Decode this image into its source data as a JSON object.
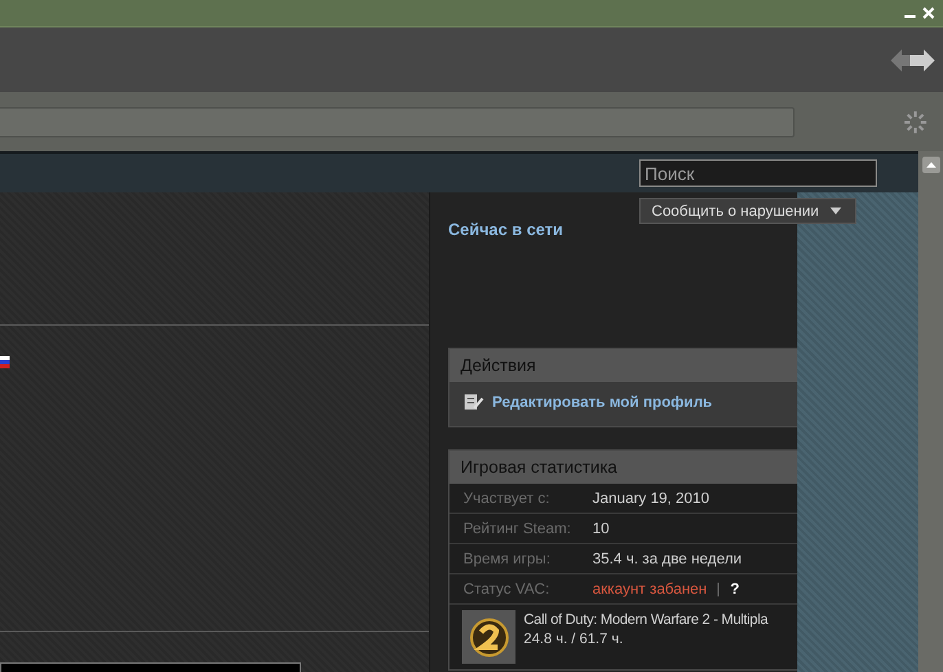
{
  "header": {
    "search": {
      "placeholder": "Поиск"
    }
  },
  "report_button": {
    "label": "Сообщить о нарушении"
  },
  "online_status": "Сейчас в сети",
  "actions": {
    "title": "Действия",
    "items": [
      {
        "label": "Редактировать мой профиль"
      }
    ]
  },
  "stats": {
    "title": "Игровая статистика",
    "rows": [
      {
        "label": "Участвует с:",
        "value": "January 19, 2010",
        "kind": "text"
      },
      {
        "label": "Рейтинг Steam:",
        "value": "10",
        "kind": "text"
      },
      {
        "label": "Время игры:",
        "value": "35.4 ч. за две недели",
        "kind": "text"
      },
      {
        "label": "Статус VAC:",
        "value": "аккаунт забанен",
        "kind": "vac",
        "help": "?"
      }
    ],
    "games": [
      {
        "name": "Call of Duty: Modern Warfare 2 - Multipla",
        "hours": "24.8 ч. / 61.7 ч."
      }
    ]
  }
}
